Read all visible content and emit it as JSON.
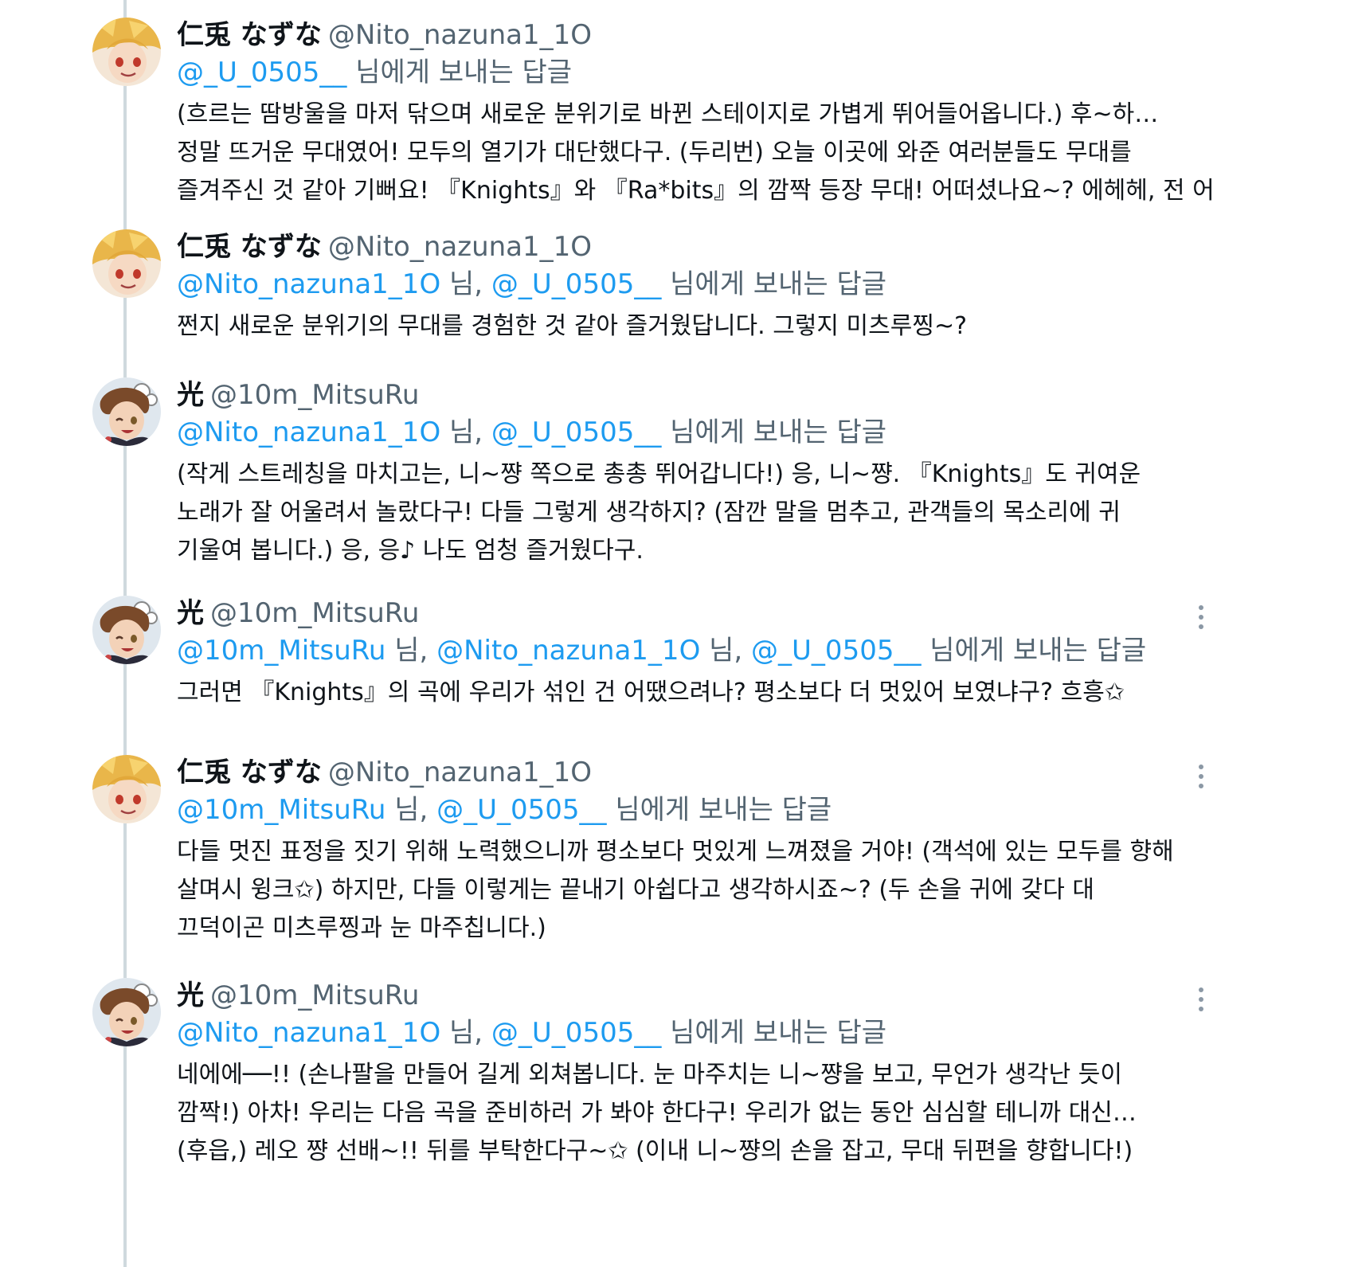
{
  "replies": [
    {
      "name": "仁兎 なずな",
      "handle": "@Nito_nazuna1_1O",
      "mentions": [
        "@_U_0505__"
      ],
      "replying_suffix": "님에게 보내는 답글",
      "text_lines": [
        "(흐르는 땀방울을 마저 닦으며 새로운 분위기로 바뀐 스테이지로 가볍게 뛰어들어옵니다.) 후~하…",
        "정말 뜨거운 무대였어! 모두의 열기가 대단했다구. (두리번) 오늘 이곳에 와준 여러분들도 무대를",
        "즐겨주신 것 같아 기뻐요! 『Knights』와 『Ra*bits』의 깜짝 등장 무대! 어떠셨나요~? 에헤헤, 전 어"
      ],
      "avatar": "nazuna-avatar",
      "has_more": false
    },
    {
      "name": "仁兎 なずな",
      "handle": "@Nito_nazuna1_1O",
      "mentions": [
        "@Nito_nazuna1_1O",
        "@_U_0505__"
      ],
      "replying_suffix": "님에게 보내는 답글",
      "text_lines": [
        "쩐지 새로운 분위기의 무대를 경험한 것 같아 즐거웠답니다. 그렇지 미츠루찡~?"
      ],
      "avatar": "nazuna-avatar",
      "has_more": false
    },
    {
      "name": "光",
      "handle": "@10m_MitsuRu",
      "mentions": [
        "@Nito_nazuna1_1O",
        "@_U_0505__"
      ],
      "replying_suffix": "님에게 보내는 답글",
      "text_lines": [
        "(작게 스트레칭을 마치고는, 니~쨩 쪽으로 총총 뛰어갑니다!) 응, 니~쨩. 『Knights』도 귀여운",
        "노래가 잘 어울려서 놀랐다구! 다들 그렇게 생각하지? (잠깐 말을 멈추고, 관객들의 목소리에 귀",
        "기울여 봅니다.) 응, 응♪ 나도 엄청 즐거웠다구."
      ],
      "avatar": "mitsuru-avatar",
      "has_more": false
    },
    {
      "name": "光",
      "handle": "@10m_MitsuRu",
      "mentions": [
        "@10m_MitsuRu",
        "@Nito_nazuna1_1O",
        "@_U_0505__"
      ],
      "replying_suffix": "님에게 보내는 답글",
      "text_lines": [
        "그러면 『Knights』의 곡에 우리가 섞인 건 어땠으려나? 평소보다 더 멋있어 보였냐구? 흐흥✩"
      ],
      "avatar": "mitsuru-avatar",
      "has_more": true
    },
    {
      "name": "仁兎 なずな",
      "handle": "@Nito_nazuna1_1O",
      "mentions": [
        "@10m_MitsuRu",
        "@_U_0505__"
      ],
      "replying_suffix": "님에게 보내는 답글",
      "text_lines": [
        "다들 멋진 표정을 짓기 위해 노력했으니까 평소보다 멋있게 느껴졌을 거야! (객석에 있는 모두를 향해",
        "살며시 윙크✩) 하지만, 다들 이렇게는 끝내기 아쉽다고 생각하시죠~? (두 손을 귀에 갖다 대",
        "끄덕이곤 미츠루찡과 눈 마주칩니다.)"
      ],
      "avatar": "nazuna-avatar",
      "has_more": true
    },
    {
      "name": "光",
      "handle": "@10m_MitsuRu",
      "mentions": [
        "@Nito_nazuna1_1O",
        "@_U_0505__"
      ],
      "replying_suffix": "님에게 보내는 답글",
      "text_lines": [
        "네에에──!! (손나팔을 만들어 길게 외쳐봅니다. 눈 마주치는 니~쨩을 보고, 무언가 생각난 듯이",
        "깜짝!) 아차! 우리는 다음 곡을 준비하러 가 봐야 한다구! 우리가 없는 동안 심심할 테니까 대신…",
        "(후읍,) 레오 쨩 선배~!! 뒤를 부탁한다구~✩ (이내 니~쨩의 손을 잡고, 무대 뒤편을 향합니다!)"
      ],
      "avatar": "mitsuru-avatar",
      "has_more": true
    }
  ],
  "mention_separator": "님,",
  "colors": {
    "mention": "#1d9bf0",
    "secondary_text": "#536471",
    "primary_text": "#0f1419",
    "thread_line": "#cfd9de"
  }
}
